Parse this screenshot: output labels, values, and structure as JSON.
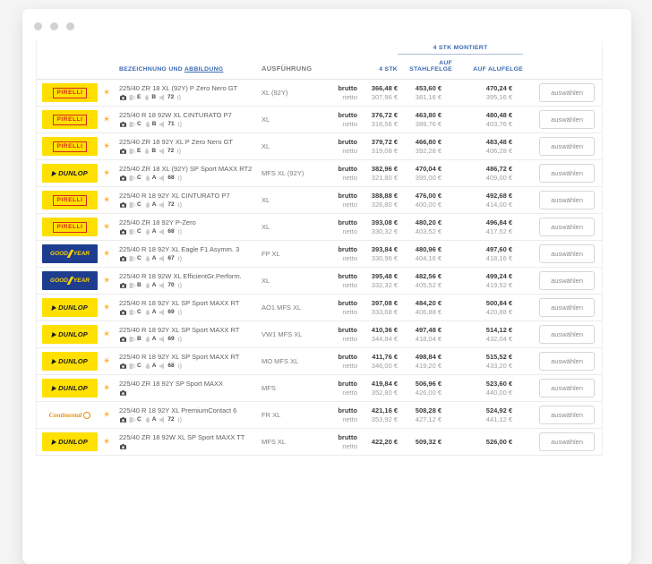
{
  "window": {
    "controls": "three-dots"
  },
  "icons": {
    "sun": "☀"
  },
  "colors": {
    "header_blue": "#3a68b2",
    "pirelli_yellow": "#ffdf00",
    "pirelli_red": "#d52b1e",
    "dunlop_yellow": "#ffe000",
    "goodyear_blue": "#1e3d8f",
    "goodyear_yellow": "#ffd400",
    "continental_orange": "#e2920c",
    "price_gross": "#3c3c3c",
    "price_net": "#9e9e9e"
  },
  "brands": {
    "pirelli": "PIRELLI",
    "dunlop": "DUNLOP",
    "goodyear_left": "GOOD",
    "goodyear_right": "YEAR",
    "continental": "Continental"
  },
  "table": {
    "header": {
      "group_label": "4 STK MONTIERT",
      "col_description_a": "BEZEICHNUNG UND ",
      "col_description_b": "ABBILDUNG",
      "col_version": "AUSFÜHRUNG",
      "col_qty": "4 STK",
      "col_steel": "AUF STAHLFELGE",
      "col_alloy": "AUF ALUFELGE"
    },
    "price_row_labels": {
      "gross": "brutto",
      "net": "netto"
    },
    "button_label": "auswählen",
    "rows": [
      {
        "brand": "pirelli",
        "season": "summer",
        "name": "225/40 ZR 18 XL (92Y) P Zero Nero GT",
        "labels": {
          "fuel": "E",
          "wet": "B",
          "noise": "72"
        },
        "version": "XL (92Y)",
        "qty4": {
          "gross": "366,48 €",
          "net": "307,96 €"
        },
        "steel": {
          "gross": "453,60 €",
          "net": "381,16 €"
        },
        "alloy": {
          "gross": "470,24 €",
          "net": "395,16 €"
        }
      },
      {
        "brand": "pirelli",
        "season": "summer",
        "name": "225/40 R 18 92W XL CINTURATO P7",
        "labels": {
          "fuel": "C",
          "wet": "B",
          "noise": "71"
        },
        "version": "XL",
        "qty4": {
          "gross": "376,72 €",
          "net": "316,56 €"
        },
        "steel": {
          "gross": "463,80 €",
          "net": "389,76 €"
        },
        "alloy": {
          "gross": "480,48 €",
          "net": "403,76 €"
        }
      },
      {
        "brand": "pirelli",
        "season": "summer",
        "name": "225/40 ZR 18 92Y XL P Zero Nero GT",
        "labels": {
          "fuel": "E",
          "wet": "B",
          "noise": "72"
        },
        "version": "XL",
        "qty4": {
          "gross": "379,72 €",
          "net": "319,08 €"
        },
        "steel": {
          "gross": "466,80 €",
          "net": "392,28 €"
        },
        "alloy": {
          "gross": "483,48 €",
          "net": "406,28 €"
        }
      },
      {
        "brand": "dunlop",
        "season": "summer",
        "name": "225/40 ZR 18 XL (92Y) SP Sport MAXX RT2",
        "labels": {
          "fuel": "C",
          "wet": "A",
          "noise": "68"
        },
        "version": "MFS XL (92Y)",
        "qty4": {
          "gross": "382,96 €",
          "net": "321,80 €"
        },
        "steel": {
          "gross": "470,04 €",
          "net": "395,00 €"
        },
        "alloy": {
          "gross": "486,72 €",
          "net": "409,00 €"
        }
      },
      {
        "brand": "pirelli",
        "season": "summer",
        "name": "225/40 R 18 92Y XL CINTURATO P7",
        "labels": {
          "fuel": "C",
          "wet": "A",
          "noise": "72"
        },
        "version": "XL",
        "qty4": {
          "gross": "388,88 €",
          "net": "326,80 €"
        },
        "steel": {
          "gross": "476,00 €",
          "net": "400,00 €"
        },
        "alloy": {
          "gross": "492,68 €",
          "net": "414,00 €"
        }
      },
      {
        "brand": "pirelli",
        "season": "summer",
        "name": "225/40 ZR 18 92Y P-Zero",
        "labels": {
          "fuel": "C",
          "wet": "A",
          "noise": "68"
        },
        "version": "XL",
        "qty4": {
          "gross": "393,08 €",
          "net": "330,32 €"
        },
        "steel": {
          "gross": "480,20 €",
          "net": "403,52 €"
        },
        "alloy": {
          "gross": "496,84 €",
          "net": "417,52 €"
        }
      },
      {
        "brand": "goodyear",
        "season": "summer",
        "name": "225/40 R 18 92Y XL Eagle F1 Asymm. 3",
        "labels": {
          "fuel": "C",
          "wet": "A",
          "noise": "67"
        },
        "version": "FP XL",
        "qty4": {
          "gross": "393,84 €",
          "net": "330,96 €"
        },
        "steel": {
          "gross": "480,96 €",
          "net": "404,16 €"
        },
        "alloy": {
          "gross": "497,60 €",
          "net": "418,16 €"
        }
      },
      {
        "brand": "goodyear",
        "season": "summer",
        "name": "225/40 R 18 92W XL EfficientGr.Perform.",
        "labels": {
          "fuel": "B",
          "wet": "A",
          "noise": "70"
        },
        "version": "XL",
        "qty4": {
          "gross": "395,48 €",
          "net": "332,32 €"
        },
        "steel": {
          "gross": "482,56 €",
          "net": "405,52 €"
        },
        "alloy": {
          "gross": "499,24 €",
          "net": "419,52 €"
        }
      },
      {
        "brand": "dunlop",
        "season": "summer",
        "name": "225/40 R 18 92Y XL SP Sport MAXX RT",
        "labels": {
          "fuel": "C",
          "wet": "A",
          "noise": "69"
        },
        "version": "AO1 MFS XL",
        "qty4": {
          "gross": "397,08 €",
          "net": "333,68 €"
        },
        "steel": {
          "gross": "484,20 €",
          "net": "406,88 €"
        },
        "alloy": {
          "gross": "500,84 €",
          "net": "420,88 €"
        }
      },
      {
        "brand": "dunlop",
        "season": "summer",
        "name": "225/40 R 18 92Y XL SP Sport MAXX RT",
        "labels": {
          "fuel": "B",
          "wet": "A",
          "noise": "69"
        },
        "version": "VW1 MFS XL",
        "qty4": {
          "gross": "410,36 €",
          "net": "344,84 €"
        },
        "steel": {
          "gross": "497,48 €",
          "net": "418,04 €"
        },
        "alloy": {
          "gross": "514,12 €",
          "net": "432,04 €"
        }
      },
      {
        "brand": "dunlop",
        "season": "summer",
        "name": "225/40 R 18 92Y XL SP Sport MAXX RT",
        "labels": {
          "fuel": "C",
          "wet": "A",
          "noise": "68"
        },
        "version": "MO MFS XL",
        "qty4": {
          "gross": "411,76 €",
          "net": "346,00 €"
        },
        "steel": {
          "gross": "498,84 €",
          "net": "419,20 €"
        },
        "alloy": {
          "gross": "515,52 €",
          "net": "433,20 €"
        }
      },
      {
        "brand": "dunlop",
        "season": "summer",
        "name": "225/40 ZR 18 92Y SP Sport MAXX",
        "labels": {
          "fuel": "",
          "wet": "",
          "noise": ""
        },
        "version": "MFS",
        "qty4": {
          "gross": "419,84 €",
          "net": "352,80 €"
        },
        "steel": {
          "gross": "506,96 €",
          "net": "426,00 €"
        },
        "alloy": {
          "gross": "523,60 €",
          "net": "440,00 €"
        }
      },
      {
        "brand": "continental",
        "season": "summer",
        "name": "225/40 R 18 92Y XL PremiumContact 6",
        "labels": {
          "fuel": "C",
          "wet": "A",
          "noise": "72"
        },
        "version": "FR XL",
        "qty4": {
          "gross": "421,16 €",
          "net": "353,92 €"
        },
        "steel": {
          "gross": "508,28 €",
          "net": "427,12 €"
        },
        "alloy": {
          "gross": "524,92 €",
          "net": "441,12 €"
        }
      },
      {
        "brand": "dunlop",
        "season": "summer",
        "name": "225/40 ZR 18 92W XL SP Sport MAXX TT",
        "labels": {
          "fuel": "",
          "wet": "",
          "noise": ""
        },
        "version": "MFS XL",
        "qty4": {
          "gross": "422,20 €",
          "net": ""
        },
        "steel": {
          "gross": "509,32 €",
          "net": ""
        },
        "alloy": {
          "gross": "526,00 €",
          "net": ""
        }
      }
    ]
  }
}
